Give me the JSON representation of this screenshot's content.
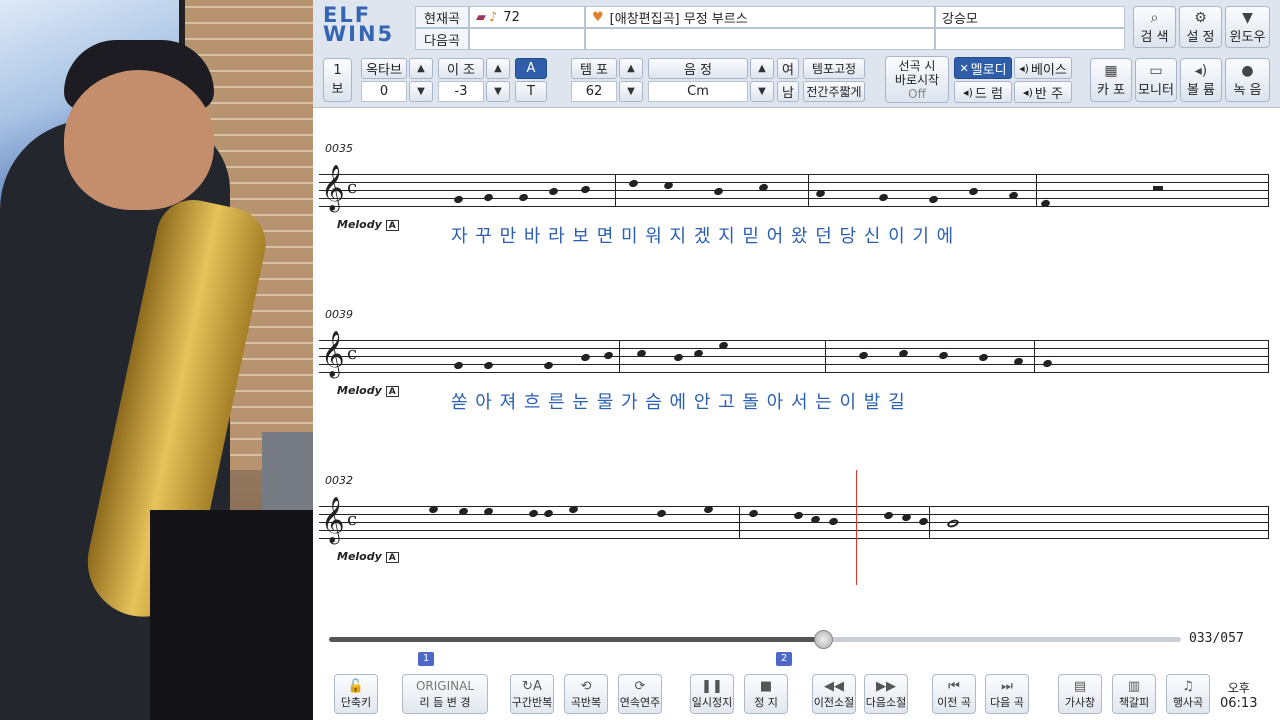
{
  "app": {
    "logo": "ELF WIN5"
  },
  "topbar": {
    "current_label": "현재곡",
    "next_label": "다음곡",
    "song_number": "72",
    "song_title": "[애창편집곡] 무정 부르스",
    "singer": "강승모",
    "right_buttons": [
      {
        "label": "검 색",
        "icon": "search-icon"
      },
      {
        "label": "설 정",
        "icon": "gear-icon"
      },
      {
        "label": "윈도우",
        "icon": "chevron-down-icon"
      }
    ],
    "verse": {
      "num": "1",
      "label": "보"
    },
    "octave": {
      "label": "옥타브",
      "value": "0"
    },
    "key": {
      "label": "이 조",
      "value": "-3"
    },
    "at": {
      "a": "A",
      "t": "T"
    },
    "tempo": {
      "label": "템 포",
      "value": "62"
    },
    "pitch": {
      "label": "음 정",
      "value": "Cm"
    },
    "gender": {
      "female": "여",
      "male": "남"
    },
    "tempo_fix": "템포고정",
    "interlude": "전간주짧게",
    "instant_start": {
      "line1": "선곡 시",
      "line2": "바로시작",
      "state": "Off"
    },
    "parts": {
      "melody": "멜로디",
      "bass": "베이스",
      "drum": "드 럼",
      "accomp": "반 주"
    },
    "tools": [
      {
        "label": "카 포",
        "icon": "capo-icon"
      },
      {
        "label": "모니터",
        "icon": "monitor-icon"
      },
      {
        "label": "볼 륨",
        "icon": "volume-icon"
      },
      {
        "label": "녹 음",
        "icon": "record-icon"
      }
    ]
  },
  "score": {
    "systems": [
      {
        "measure": "0035",
        "instrument": "Melody",
        "lyrics": "자 꾸 만  바 라 보 면  미 워  지 겠 지     믿 어  왔        던  당 신    이 기  에"
      },
      {
        "measure": "0039",
        "instrument": "Melody",
        "lyrics": "쏟 아     져 흐 른  눈 물  가 슴 에  안 고                    돌 아 서    는        이 발  길"
      },
      {
        "measure": "0032",
        "instrument": "Melody",
        "lyrics": ""
      }
    ]
  },
  "progress": {
    "fraction": 0.58,
    "counter": "033/057",
    "markers": [
      "1",
      "2"
    ]
  },
  "bottombar": {
    "buttons": [
      {
        "label": "단축키",
        "icon": "lock-icon"
      },
      {
        "label": "리 듬 변 경",
        "icon": "original-text",
        "top": "ORIGINAL"
      },
      {
        "label": "구간반복",
        "icon": "repeat-a-icon"
      },
      {
        "label": "곡반복",
        "icon": "repeat-song-icon"
      },
      {
        "label": "연속연주",
        "icon": "continuous-icon"
      },
      {
        "label": "일시정지",
        "icon": "pause-icon"
      },
      {
        "label": "정 지",
        "icon": "stop-icon"
      },
      {
        "label": "이전소절",
        "icon": "rewind-icon"
      },
      {
        "label": "다음소절",
        "icon": "fast-forward-icon"
      },
      {
        "label": "이전 곡",
        "icon": "previous-icon"
      },
      {
        "label": "다음 곡",
        "icon": "next-icon"
      },
      {
        "label": "가사창",
        "icon": "lyrics-window-icon"
      },
      {
        "label": "책갈피",
        "icon": "bookmark-icon"
      },
      {
        "label": "행사곡",
        "icon": "event-icon"
      }
    ],
    "clock": {
      "ampm": "오후",
      "time": "06:13"
    }
  }
}
